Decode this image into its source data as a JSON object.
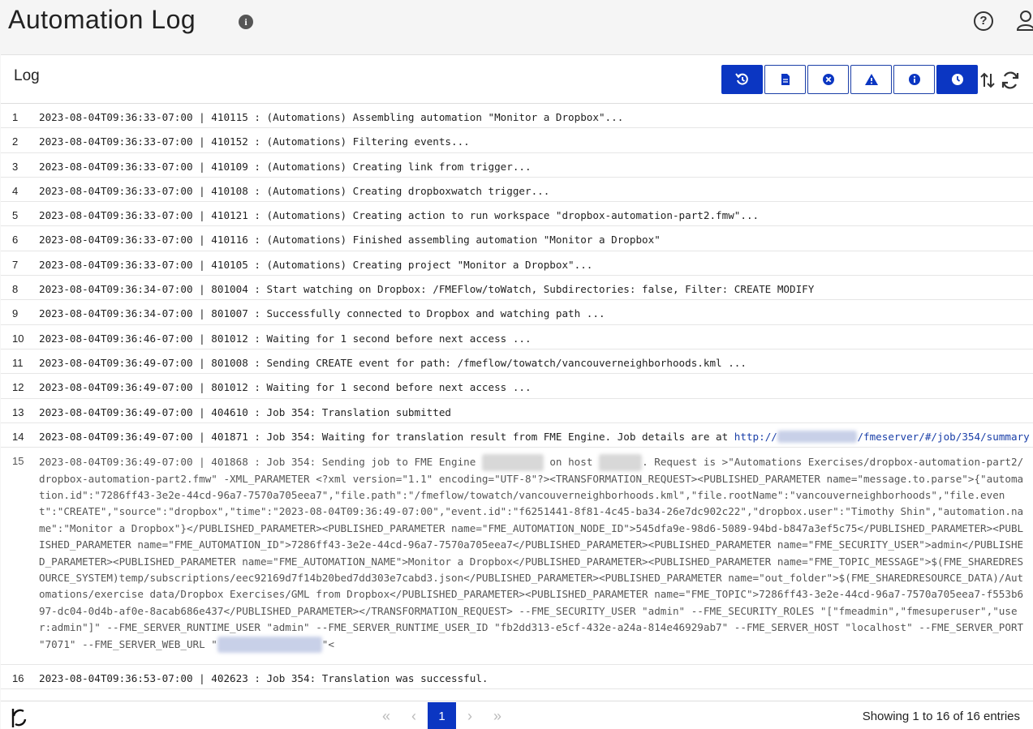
{
  "header": {
    "title": "Automation Log",
    "info_icon": "info-circle-icon",
    "help_icon": "question-circle-icon",
    "user_icon": "user-icon"
  },
  "panel": {
    "title": "Log",
    "toolbar": [
      {
        "name": "restore",
        "icon": "history-icon",
        "active": true
      },
      {
        "name": "document",
        "icon": "file-icon",
        "active": false
      },
      {
        "name": "error",
        "icon": "x-circle-icon",
        "active": false
      },
      {
        "name": "warning",
        "icon": "warning-icon",
        "active": false
      },
      {
        "name": "info",
        "icon": "info-icon",
        "active": false
      },
      {
        "name": "time",
        "icon": "clock-icon",
        "active": true
      }
    ],
    "accent": "#0b36c2"
  },
  "log": [
    {
      "num": "1",
      "text": "2023-08-04T09:36:33-07:00 | 410115 : (Automations) Assembling automation \"Monitor a Dropbox\"..."
    },
    {
      "num": "2",
      "text": "2023-08-04T09:36:33-07:00 | 410152 : (Automations) Filtering events..."
    },
    {
      "num": "3",
      "text": "2023-08-04T09:36:33-07:00 | 410109 : (Automations) Creating link from trigger..."
    },
    {
      "num": "4",
      "text": "2023-08-04T09:36:33-07:00 | 410108 : (Automations) Creating dropboxwatch trigger..."
    },
    {
      "num": "5",
      "text": "2023-08-04T09:36:33-07:00 | 410121 : (Automations) Creating action to run workspace \"dropbox-automation-part2.fmw\"..."
    },
    {
      "num": "6",
      "text": "2023-08-04T09:36:33-07:00 | 410116 : (Automations) Finished assembling automation \"Monitor a Dropbox\""
    },
    {
      "num": "7",
      "text": "2023-08-04T09:36:33-07:00 | 410105 : (Automations) Creating project \"Monitor a Dropbox\"..."
    },
    {
      "num": "8",
      "text": "2023-08-04T09:36:34-07:00 | 801004 : Start watching on Dropbox: /FMEFlow/toWatch, Subdirectories: false, Filter: CREATE MODIFY"
    },
    {
      "num": "9",
      "text": "2023-08-04T09:36:34-07:00 | 801007 : Successfully connected to Dropbox and watching path ..."
    },
    {
      "num": "10",
      "text": "2023-08-04T09:36:46-07:00 | 801012 : Waiting for 1 second before next access ..."
    },
    {
      "num": "11",
      "text": "2023-08-04T09:36:49-07:00 | 801008 : Sending CREATE event for path: /fmeflow/towatch/vancouverneighborhoods.kml ..."
    },
    {
      "num": "12",
      "text": "2023-08-04T09:36:49-07:00 | 801012 : Waiting for 1 second before next access ..."
    },
    {
      "num": "13",
      "text": "2023-08-04T09:36:49-07:00 | 404610 : Job 354: Translation submitted"
    }
  ],
  "row14": {
    "num": "14",
    "text": "2023-08-04T09:36:49-07:00 | 401871 : Job 354: Waiting for translation result from FME Engine. Job details are at ",
    "link_prefix": "http://",
    "link_suffix": "/fmeserver/#/job/354/summary"
  },
  "row15": {
    "num": "15",
    "part1": "2023-08-04T09:36:49-07:00 | 401868 : Job 354: Sending job to FME Engine ",
    "part2": " on host ",
    "part3": ". Request is >\"Automations Exercises/dropbox-automation-part2/dropbox-automation-part2.fmw\" -XML_PARAMETER <?xml version=\"1.1\" encoding=\"UTF-8\"?><TRANSFORMATION_REQUEST><PUBLISHED_PARAMETER name=\"message.to.parse\">{\"automation.id\":\"7286ff43-3e2e-44cd-96a7-7570a705eea7\",\"file.path\":\"/fmeflow/towatch/vancouverneighborhoods.kml\",\"file.rootName\":\"vancouverneighborhoods\",\"file.event\":\"CREATE\",\"source\":\"dropbox\",\"time\":\"2023-08-04T09:36:49-07:00\",\"event.id\":\"f6251441-8f81-4c45-ba34-26e7dc902c22\",\"dropbox.user\":\"Timothy Shin\",\"automation.name\":\"Monitor a Dropbox\"}</PUBLISHED_PARAMETER><PUBLISHED_PARAMETER name=\"FME_AUTOMATION_NODE_ID\">545dfa9e-98d6-5089-94bd-b847a3ef5c75</PUBLISHED_PARAMETER><PUBLISHED_PARAMETER name=\"FME_AUTOMATION_ID\">7286ff43-3e2e-44cd-96a7-7570a705eea7</PUBLISHED_PARAMETER><PUBLISHED_PARAMETER name=\"FME_SECURITY_USER\">admin</PUBLISHED_PARAMETER><PUBLISHED_PARAMETER name=\"FME_AUTOMATION_NAME\">Monitor a Dropbox</PUBLISHED_PARAMETER><PUBLISHED_PARAMETER name=\"FME_TOPIC_MESSAGE\">$(FME_SHAREDRESOURCE_SYSTEM)temp/subscriptions/eec92169d7f14b20bed7dd303e7cabd3.json</PUBLISHED_PARAMETER><PUBLISHED_PARAMETER name=\"out_folder\">$(FME_SHAREDRESOURCE_DATA)/Automations/exercise data/Dropbox Exercises/GML from Dropbox</PUBLISHED_PARAMETER><PUBLISHED_PARAMETER name=\"FME_TOPIC\">7286ff43-3e2e-44cd-96a7-7570a705eea7-f553b697-dc04-0d4b-af0e-8acab686e437</PUBLISHED_PARAMETER></TRANSFORMATION_REQUEST> --FME_SECURITY_USER \"admin\" --FME_SECURITY_ROLES \"[\"fmeadmin\",\"fmesuperuser\",\"user:admin\"]\" --FME_SERVER_RUNTIME_USER \"admin\" --FME_SERVER_RUNTIME_USER_ID \"fb2dd313-e5cf-432e-a24a-814e46929ab7\" --FME_SERVER_HOST \"localhost\" --FME_SERVER_PORT \"7071\" --FME_SERVER_WEB_URL \"",
    "part4": "\"<"
  },
  "row16": {
    "num": "16",
    "text": "2023-08-04T09:36:53-07:00 | 402623 : Job 354: Translation was successful."
  },
  "footer": {
    "pager": {
      "first": "«",
      "prev": "‹",
      "current": "1",
      "next": "›",
      "last": "»"
    },
    "entries": "Showing 1 to 16 of 16 entries"
  }
}
